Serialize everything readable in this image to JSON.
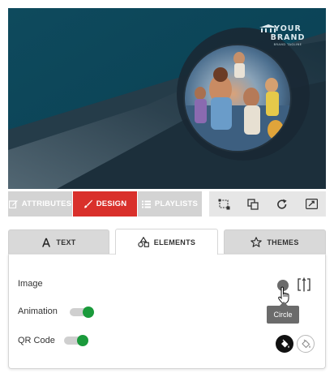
{
  "preview": {
    "brand_name": "YOUR BRAND",
    "brand_tagline": "BRAND TAGLINE",
    "logo_icon": "building-columns-icon",
    "photo_description_icon": "circle-photo"
  },
  "actionbar": {
    "attributes_label": "ATTRIBUTES",
    "design_label": "DESIGN",
    "playlists_label": "PLAYLISTS",
    "tools": [
      "resize-icon",
      "layers-icon",
      "rotate-icon",
      "expand-icon"
    ],
    "accent": "#d9302b"
  },
  "tabs": {
    "text_label": "TEXT",
    "elements_label": "ELEMENTS",
    "themes_label": "THEMES"
  },
  "panel": {
    "image_label": "Image",
    "animation_label": "Animation",
    "qr_label": "QR Code",
    "animation_on": true,
    "qr_on": true,
    "tooltip_text": "Circle",
    "toggle_color": "#1a9a3b"
  }
}
